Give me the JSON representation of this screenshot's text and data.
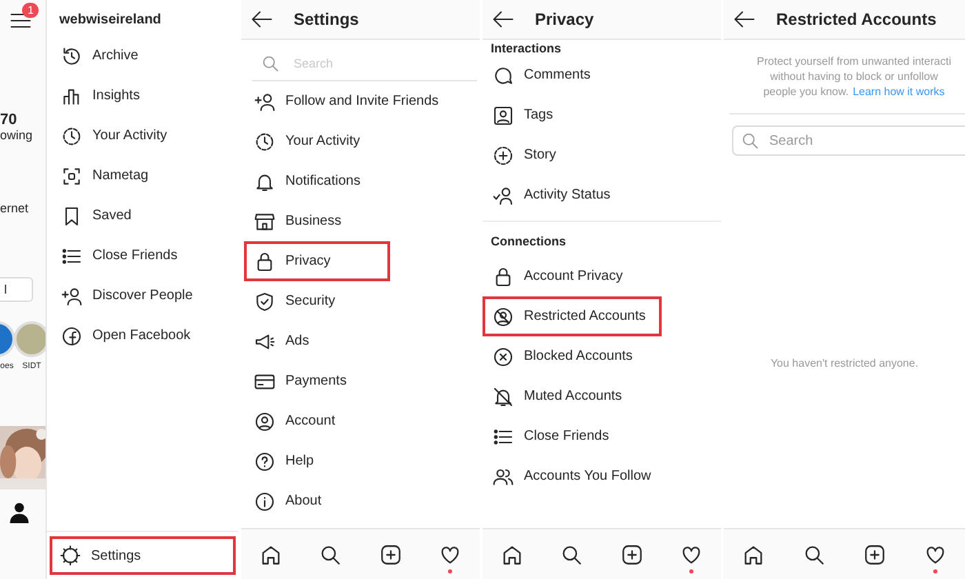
{
  "profile_strip": {
    "badge": "1",
    "stats": [
      "70",
      "owing"
    ],
    "bio": "ernet",
    "field_value": "l",
    "stories": [
      {
        "label": "oes"
      },
      {
        "label": "SIDT"
      }
    ]
  },
  "drawer": {
    "username": "webwiseireland",
    "items": [
      {
        "label": "Archive",
        "highlighted": false
      },
      {
        "label": "Insights",
        "highlighted": false
      },
      {
        "label": "Your Activity",
        "highlighted": false
      },
      {
        "label": "Nametag",
        "highlighted": false
      },
      {
        "label": "Saved",
        "highlighted": false
      },
      {
        "label": "Close Friends",
        "highlighted": false
      },
      {
        "label": "Discover People",
        "highlighted": false
      },
      {
        "label": "Open Facebook",
        "highlighted": false
      }
    ],
    "footer_item": {
      "label": "Settings",
      "highlighted": true
    }
  },
  "settings": {
    "title": "Settings",
    "search": {
      "placeholder": "Search"
    },
    "items": [
      {
        "label": "Follow and Invite Friends",
        "highlighted": false
      },
      {
        "label": "Your Activity",
        "highlighted": false
      },
      {
        "label": "Notifications",
        "highlighted": false
      },
      {
        "label": "Business",
        "highlighted": false
      },
      {
        "label": "Privacy",
        "highlighted": true
      },
      {
        "label": "Security",
        "highlighted": false
      },
      {
        "label": "Ads",
        "highlighted": false
      },
      {
        "label": "Payments",
        "highlighted": false
      },
      {
        "label": "Account",
        "highlighted": false
      },
      {
        "label": "Help",
        "highlighted": false
      },
      {
        "label": "About",
        "highlighted": false
      }
    ],
    "nav": {
      "activity_dot": true
    }
  },
  "privacy": {
    "title": "Privacy",
    "sections": [
      {
        "heading": "Interactions",
        "items": [
          {
            "label": "Comments",
            "highlighted": false
          },
          {
            "label": "Tags",
            "highlighted": false
          },
          {
            "label": "Story",
            "highlighted": false
          },
          {
            "label": "Activity Status",
            "highlighted": false
          }
        ]
      },
      {
        "heading": "Connections",
        "items": [
          {
            "label": "Account Privacy",
            "highlighted": false
          },
          {
            "label": "Restricted Accounts",
            "highlighted": true
          },
          {
            "label": "Blocked Accounts",
            "highlighted": false
          },
          {
            "label": "Muted Accounts",
            "highlighted": false
          },
          {
            "label": "Close Friends",
            "highlighted": false
          },
          {
            "label": "Accounts You Follow",
            "highlighted": false
          }
        ]
      }
    ],
    "nav": {
      "activity_dot": true
    }
  },
  "restricted": {
    "title": "Restricted Accounts",
    "description": [
      "Protect yourself from unwanted interacti",
      "without having to block or unfollow",
      "people you know."
    ],
    "link": "Learn how it works",
    "search": {
      "placeholder": "Search"
    },
    "empty_message": "You haven't restricted anyone.",
    "nav": {
      "activity_dot": true
    }
  }
}
